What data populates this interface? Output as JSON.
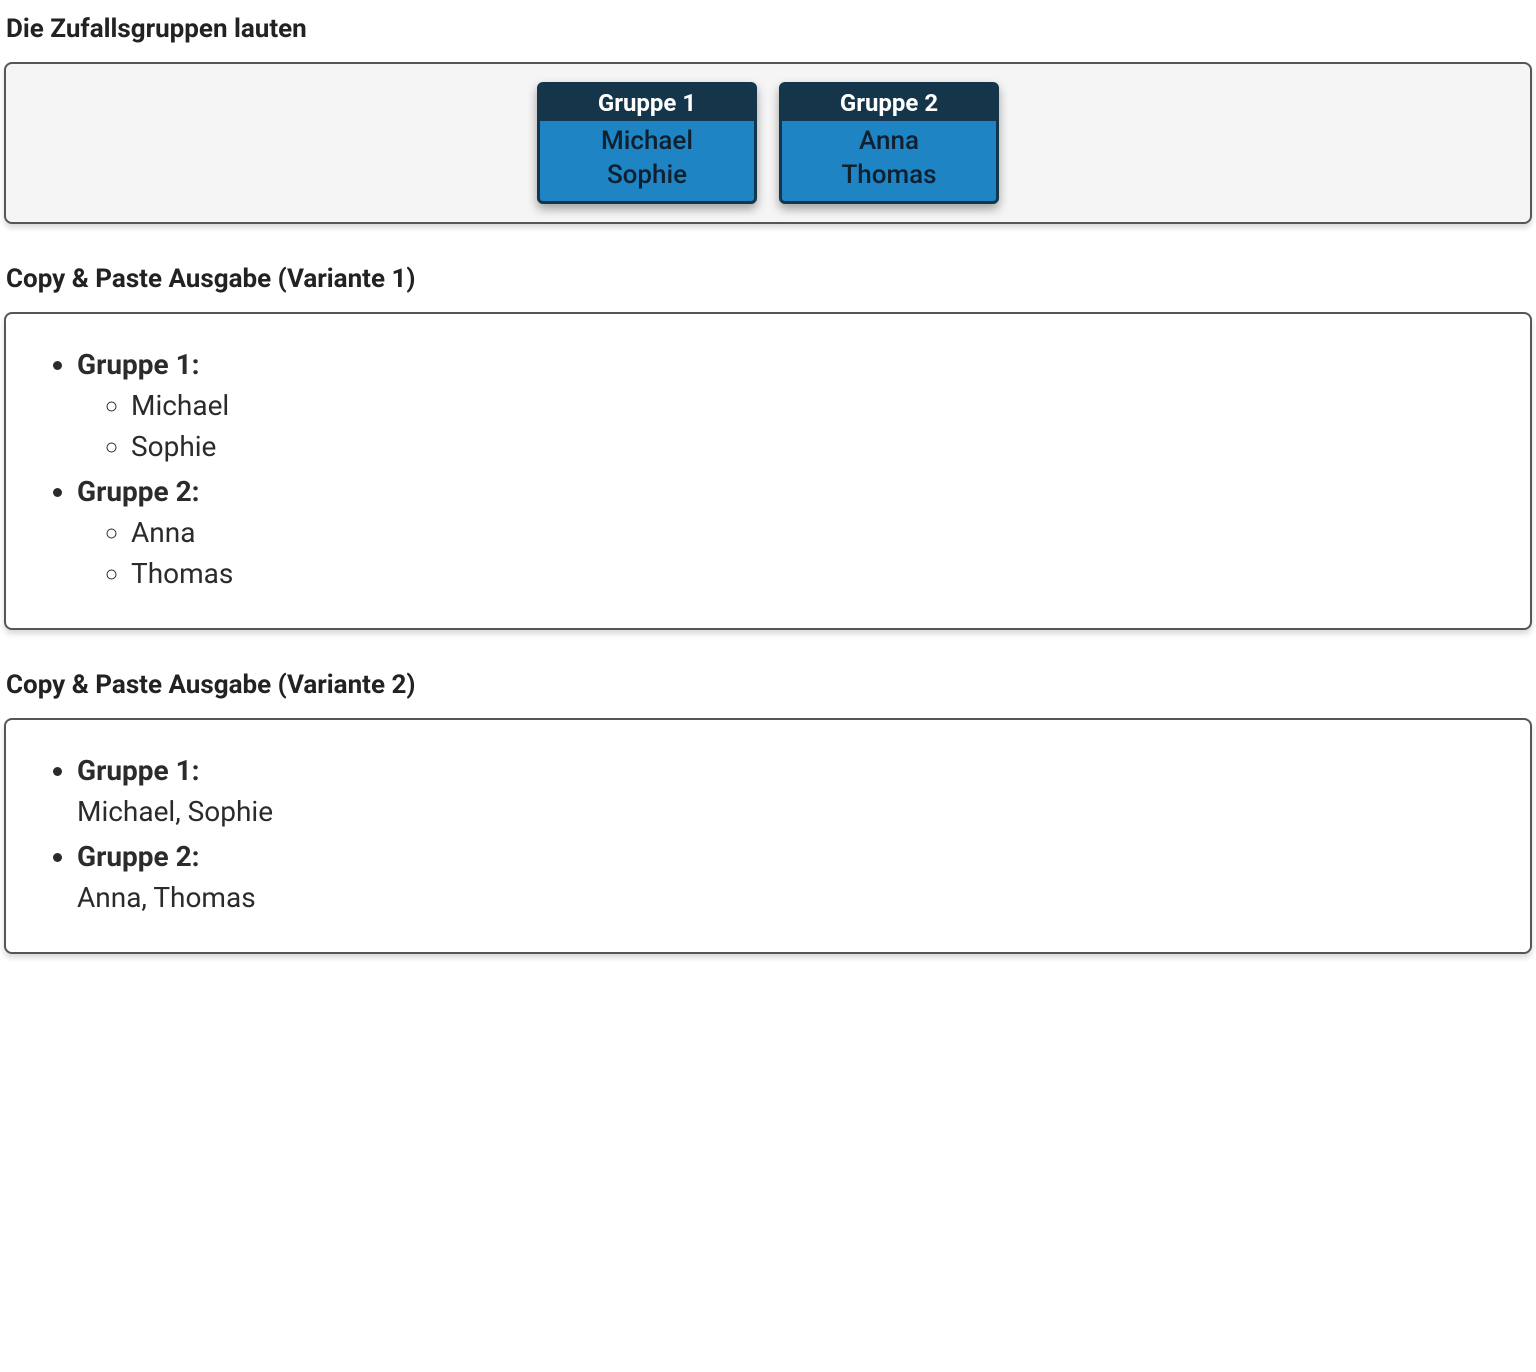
{
  "headings": {
    "groups_result": "Die Zufallsgruppen lauten",
    "variant1": "Copy & Paste Ausgabe (Variante 1)",
    "variant2": "Copy & Paste Ausgabe (Variante 2)"
  },
  "colors": {
    "card_header_bg": "#14354a",
    "card_body_bg": "#1e84c4",
    "panel_light_bg": "#f5f5f5",
    "panel_border": "#565656"
  },
  "groups": [
    {
      "name": "Gruppe 1",
      "members": [
        "Michael",
        "Sophie"
      ]
    },
    {
      "name": "Gruppe 2",
      "members": [
        "Anna",
        "Thomas"
      ]
    }
  ],
  "labels": {
    "group_suffix": ":",
    "inline_separator": ", "
  }
}
